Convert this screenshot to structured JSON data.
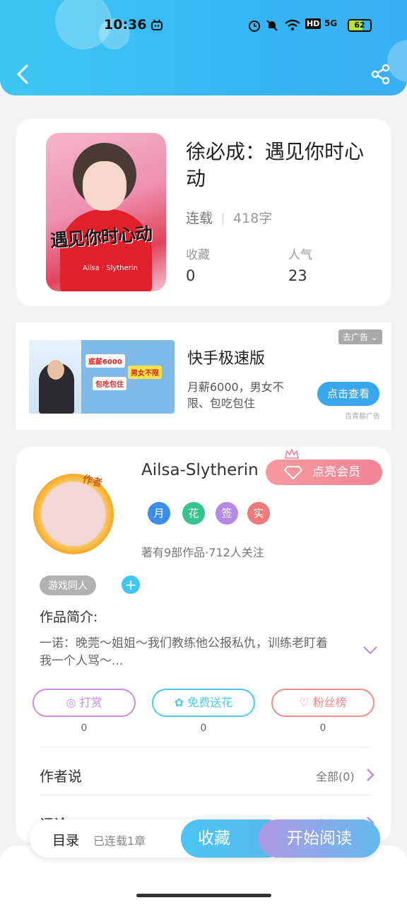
{
  "status_bar": {
    "time": "10:36",
    "network": "HD",
    "signal": "5G",
    "battery": "62"
  },
  "header": {
    "back_icon": "chevron-left-icon",
    "share_icon": "share-icon"
  },
  "book": {
    "title": "徐必成：遇见你时心动",
    "status": "连载",
    "word_count": "418字",
    "favorites_label": "收藏",
    "favorites_value": "0",
    "popularity_label": "人气",
    "popularity_value": "23",
    "cover_title": "遇见你时心动",
    "cover_author": "Ailsa · Slytherin"
  },
  "ad": {
    "title": "快手极速版",
    "description": "月薪6000，男女不限、包吃包住",
    "close_label": "去广告",
    "cta_label": "点击查看",
    "source": "百青藤广告",
    "image_tags": [
      "底薪6000",
      "男女不限",
      "包吃包住"
    ]
  },
  "author": {
    "name": "Ailsa-Slytherin",
    "avatar_tag": "作者",
    "vip_label": "点亮会员",
    "badges": [
      "月",
      "花",
      "签",
      "实"
    ],
    "stats": "著有9部作品·712人关注",
    "tag": "游戏同人",
    "intro_title": "作品简介:",
    "intro_text": "一诺：晚莞～姐姐～我们教练他公报私仇，训练老盯着我一个人骂～...",
    "actions": [
      {
        "label": "打赏",
        "count": "0",
        "color": "#c68fe0"
      },
      {
        "label": "免费送花",
        "count": "0",
        "color": "#4ccbe9"
      },
      {
        "label": "粉丝榜",
        "count": "0",
        "color": "#ef8b8b"
      }
    ],
    "author_says_label": "作者说",
    "author_says_count": "全部(0)",
    "comments_label": "评论",
    "comments_count": "全部(0)"
  },
  "bottom_bar": {
    "toc_label": "目录",
    "toc_status": "已连载1章",
    "favorite_label": "收藏",
    "read_label": "开始阅读"
  },
  "colors": {
    "header": "#3ab8f3",
    "accent": "#3fc7f3",
    "vip": "#f08595"
  }
}
